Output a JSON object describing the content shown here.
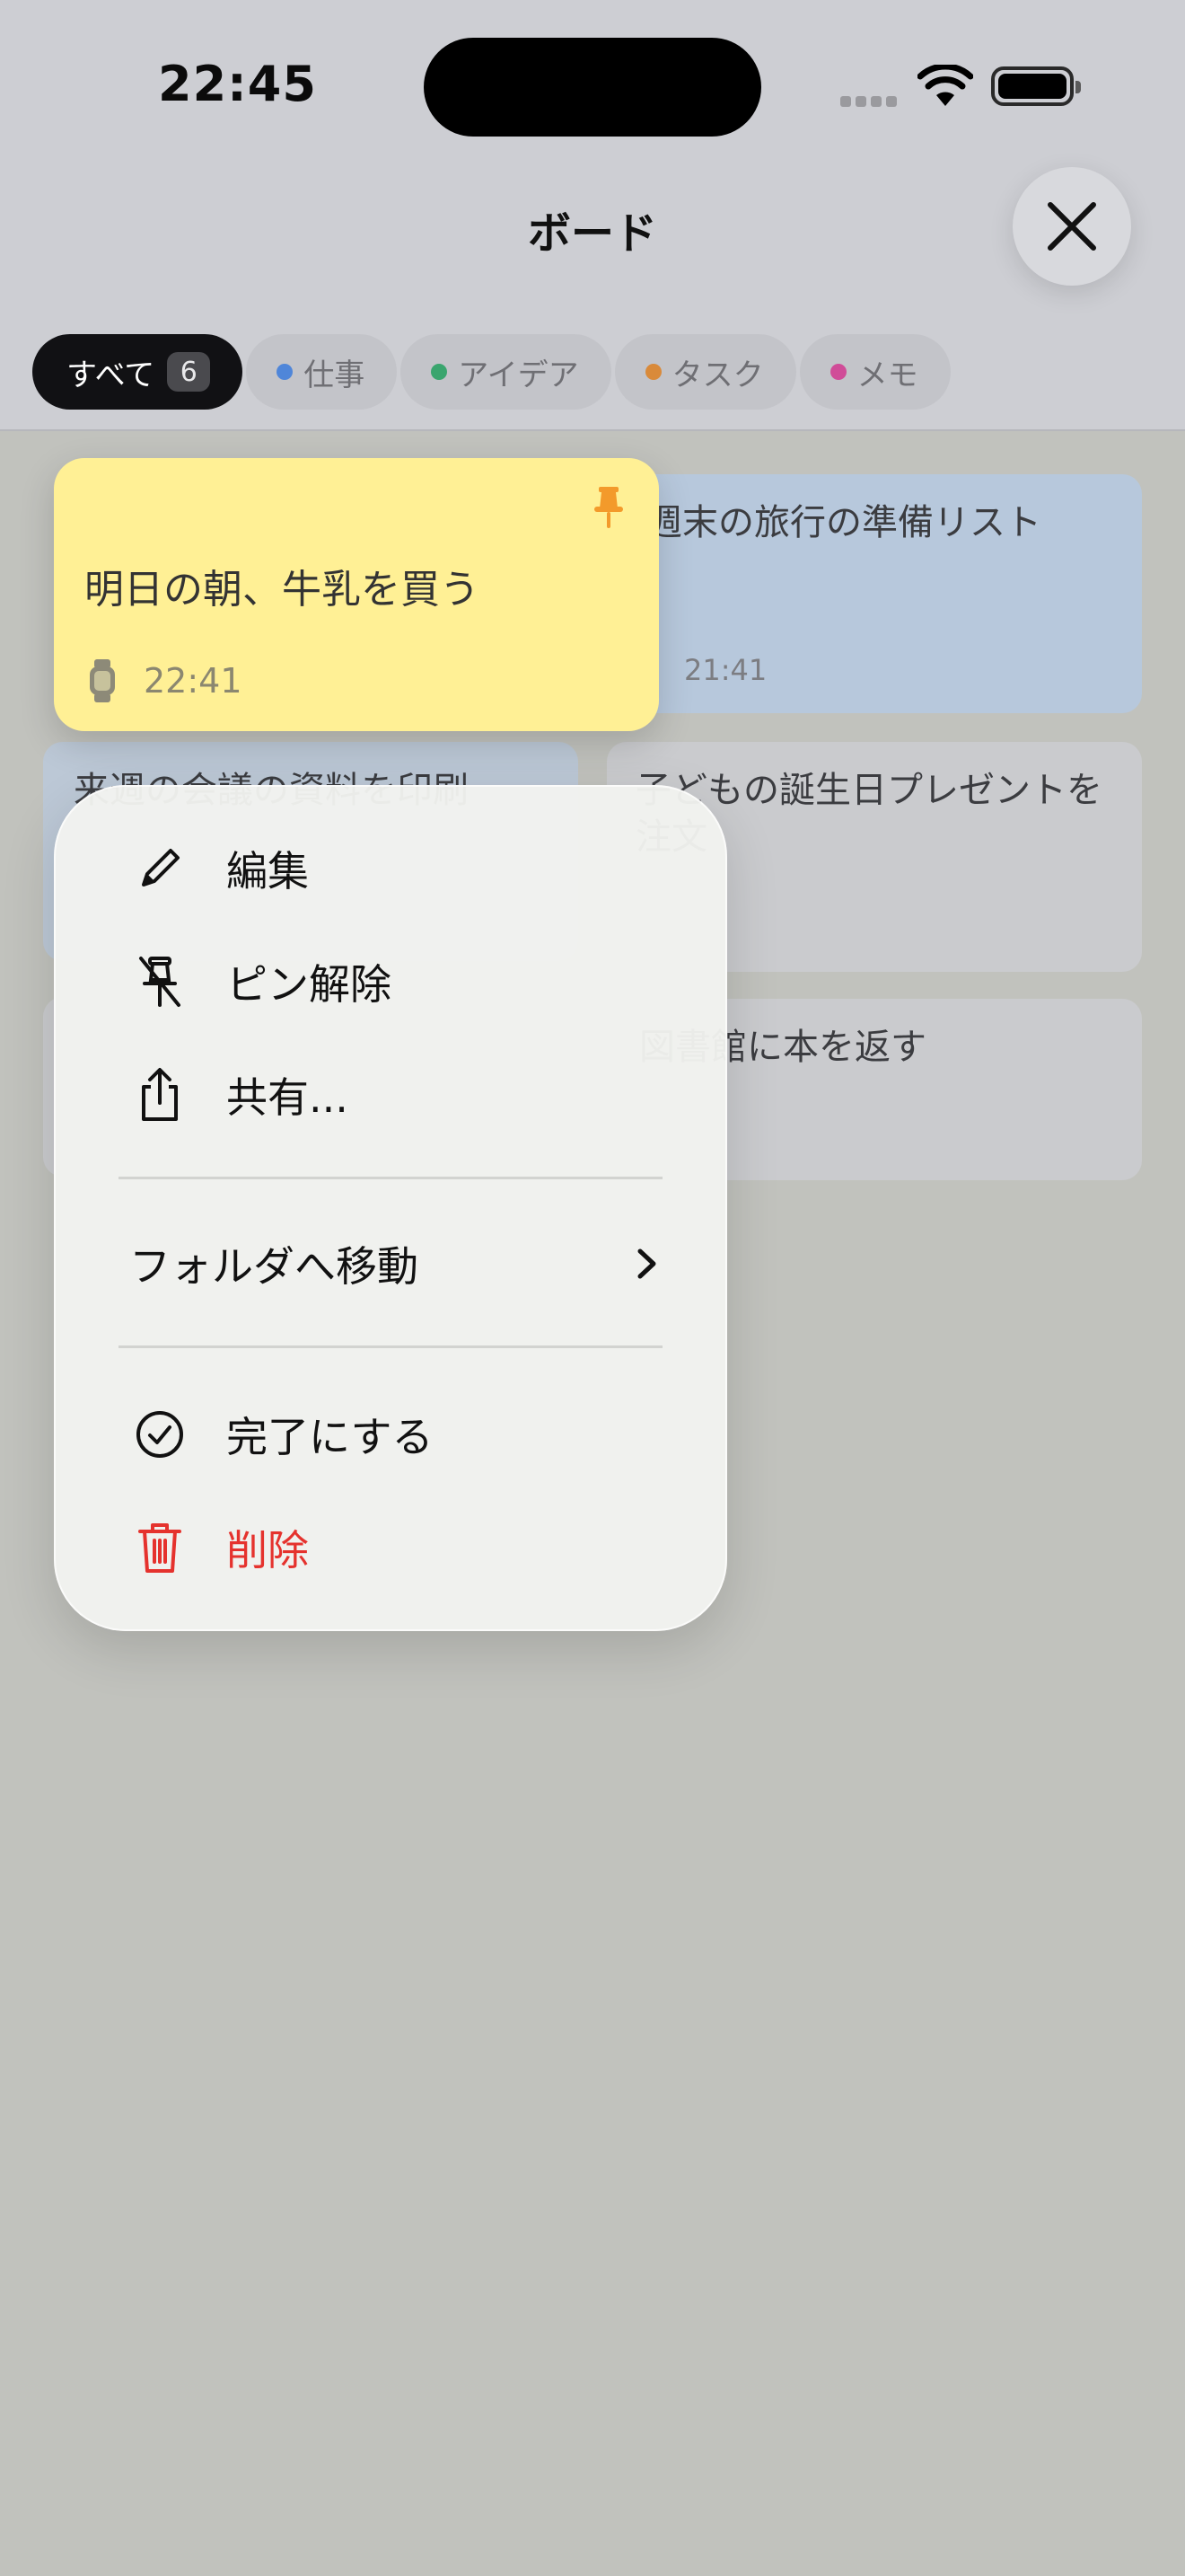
{
  "status_bar": {
    "time": "22:45"
  },
  "header": {
    "title": "ボード"
  },
  "filters": [
    {
      "label": "すべて",
      "count": "6",
      "active": true
    },
    {
      "label": "仕事",
      "dot_color": "#4f86d9"
    },
    {
      "label": "アイデア",
      "dot_color": "#3aa56e"
    },
    {
      "label": "タスク",
      "dot_color": "#d98a3a"
    },
    {
      "label": "メモ",
      "dot_color": "#d04c98"
    }
  ],
  "notes": [
    {
      "text": "週末の旅行の準備リスト",
      "time": "21:41",
      "color": "#b7c8dc"
    },
    {
      "text": "来週の会議の資料を印刷",
      "color": "#bcc8d6"
    },
    {
      "text": "子どもの誕生日プレゼントを注文",
      "color": "#cacbce"
    },
    {
      "text": "図書館に本を返す",
      "color": "#cacbce"
    }
  ],
  "selected_note": {
    "text": "明日の朝、牛乳を買う",
    "time": "22:41",
    "pinned": true,
    "color": "#fff095"
  },
  "context_menu": {
    "edit": "編集",
    "unpin": "ピン解除",
    "share": "共有...",
    "move_to_folder": "フォルダへ移動",
    "mark_done": "完了にする",
    "delete": "削除"
  },
  "colors": {
    "destructive": "#e5322d",
    "pin": "#f39a2b"
  }
}
